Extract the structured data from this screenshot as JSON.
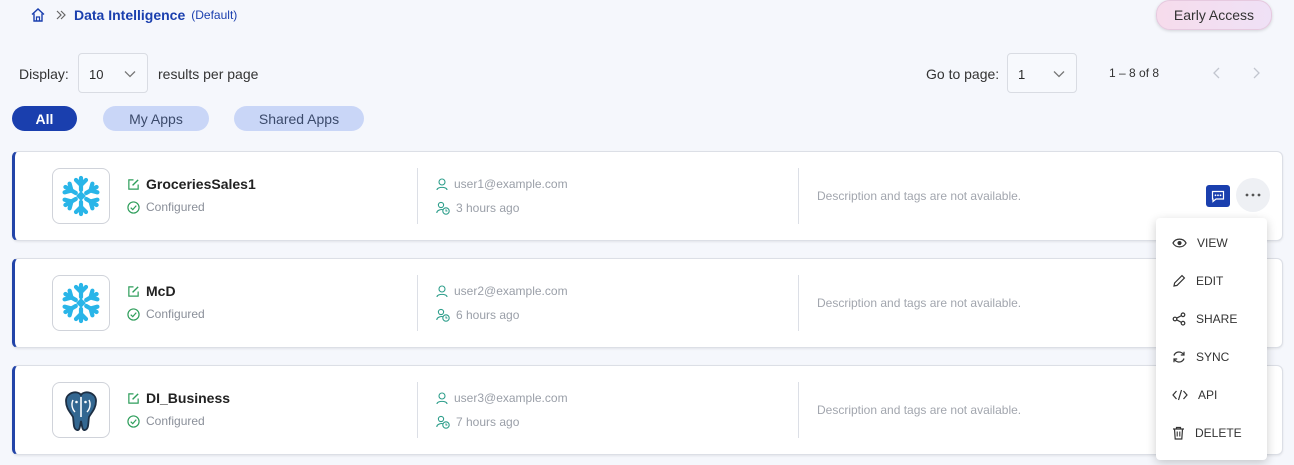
{
  "breadcrumb": {
    "title": "Data Intelligence",
    "subtitle": "(Default)"
  },
  "header": {
    "early_access_label": "Early Access"
  },
  "pagination": {
    "display_label": "Display:",
    "per_page_value": "10",
    "per_page_suffix": "results per page",
    "goto_label": "Go to page:",
    "page_value": "1",
    "range_text": "1 – 8 of 8"
  },
  "filters": {
    "all": "All",
    "my_apps": "My Apps",
    "shared_apps": "Shared Apps"
  },
  "apps": [
    {
      "name": "GroceriesSales1",
      "status": "Configured",
      "owner": "user1@example.com",
      "time": "3 hours ago",
      "description": "Description and tags are not available.",
      "icon": "snowflake-icon"
    },
    {
      "name": "McD",
      "status": "Configured",
      "owner": "user2@example.com",
      "time": "6 hours ago",
      "description": "Description and tags are not available.",
      "icon": "snowflake-icon"
    },
    {
      "name": "DI_Business",
      "status": "Configured",
      "owner": "user3@example.com",
      "time": "7 hours ago",
      "description": "Description and tags are not available.",
      "icon": "postgresql-icon"
    }
  ],
  "menu": {
    "view": "VIEW",
    "edit": "EDIT",
    "share": "SHARE",
    "sync": "SYNC",
    "api": "API",
    "delete": "DELETE"
  },
  "colors": {
    "accent": "#1a3fae",
    "filter_inactive": "#c9d6f7",
    "success": "#2e9e5b",
    "snowflake": "#29b5e8"
  }
}
